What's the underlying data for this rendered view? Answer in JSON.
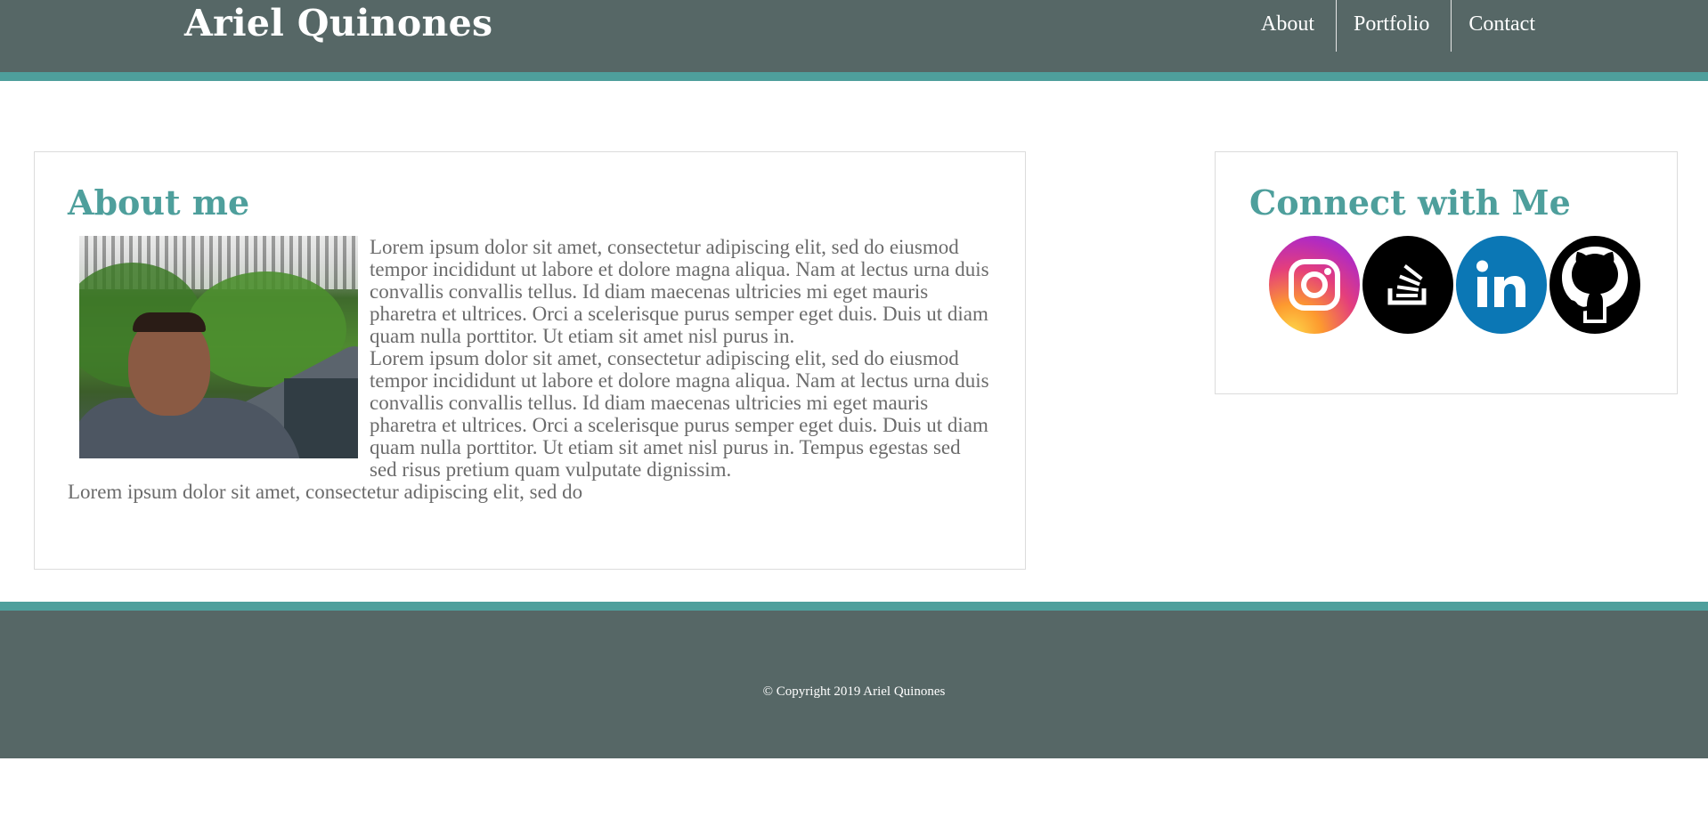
{
  "header": {
    "brand": "Ariel Quinones",
    "nav": [
      {
        "label": "About"
      },
      {
        "label": "Portfolio"
      },
      {
        "label": "Contact"
      }
    ]
  },
  "about": {
    "title": "About me",
    "photo_alt": "Portrait of Ariel Quinones",
    "paragraphs": [
      "Lorem ipsum dolor sit amet, consectetur adipiscing elit, sed do eiusmod tempor incididunt ut labore et dolore magna aliqua. Nam at lectus urna duis convallis convallis tellus. Id diam maecenas ultricies mi eget mauris pharetra et ultrices. Orci a scelerisque purus semper eget duis. Duis ut diam quam nulla porttitor. Ut etiam sit amet nisl purus in.",
      "Lorem ipsum dolor sit amet, consectetur adipiscing elit, sed do eiusmod tempor incididunt ut labore et dolore magna aliqua. Nam at lectus urna duis convallis convallis tellus. Id diam maecenas ultricies mi eget mauris pharetra et ultrices. Orci a scelerisque purus semper eget duis. Duis ut diam quam nulla porttitor. Ut etiam sit amet nisl purus in. Tempus egestas sed sed risus pretium quam vulputate dignissim.",
      "Lorem ipsum dolor sit amet, consectetur adipiscing elit, sed do"
    ]
  },
  "connect": {
    "title": "Connect with Me",
    "links": [
      {
        "icon": "instagram-icon"
      },
      {
        "icon": "stackoverflow-icon"
      },
      {
        "icon": "linkedin-icon"
      },
      {
        "icon": "github-icon"
      }
    ]
  },
  "footer": {
    "copyright": "© Copyright 2019 Ariel Quinones"
  },
  "colors": {
    "header_bg": "#566766",
    "accent": "#4e9f9c",
    "text": "#6b6b6b"
  }
}
